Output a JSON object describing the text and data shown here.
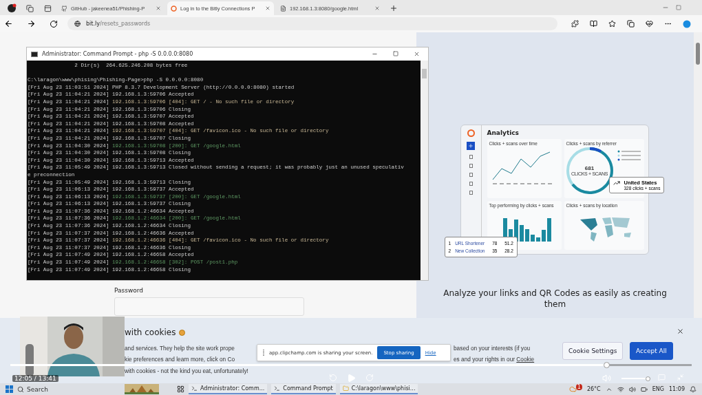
{
  "browser": {
    "tabs": [
      {
        "label": "GitHub - jakeenea51/Phishing-P",
        "kind": "github",
        "selected": false
      },
      {
        "label": "Log in to the Bitly Connections P",
        "kind": "bitly",
        "selected": true
      },
      {
        "label": "192.168.1.3:8080/google.html",
        "kind": "page",
        "selected": false
      }
    ],
    "address": {
      "host": "bit.ly",
      "path": "/resets_passwords"
    }
  },
  "cmd": {
    "title": "Administrator: Command Prompt - php  -S 0.0.0.0:8080",
    "lines": [
      {
        "text": "               2 Dir(s)  264.625.246.208 bytes free",
        "kind": "plain"
      },
      {
        "kind": "blank"
      },
      {
        "text": "C:\\laragon\\www\\phising\\Phishing-Page>php -S 0.0.0.0:8080",
        "kind": "plain"
      },
      {
        "stamp": "[Fri Aug 23 11:03:51 2024]",
        "text": "PHP 8.3.7 Development Server (http://0.0.0.0:8080) started",
        "kind": "plain"
      },
      {
        "stamp": "[Fri Aug 23 11:04:21 2024]",
        "text": "192.168.1.3:59706 Accepted",
        "kind": "plain"
      },
      {
        "stamp": "[Fri Aug 23 11:04:21 2024]",
        "text": "192.168.1.3:59706 [404]: GET / - No such file or directory",
        "kind": "warn"
      },
      {
        "stamp": "[Fri Aug 23 11:04:21 2024]",
        "text": "192.168.1.3:59706 Closing",
        "kind": "plain"
      },
      {
        "stamp": "[Fri Aug 23 11:04:21 2024]",
        "text": "192.168.1.3:59707 Accepted",
        "kind": "plain"
      },
      {
        "stamp": "[Fri Aug 23 11:04:21 2024]",
        "text": "192.168.1.3:59708 Accepted",
        "kind": "plain"
      },
      {
        "stamp": "[Fri Aug 23 11:04:21 2024]",
        "text": "192.168.1.3:59707 [404]: GET /favicon.ico - No such file or directory",
        "kind": "warn"
      },
      {
        "stamp": "[Fri Aug 23 11:04:21 2024]",
        "text": "192.168.1.3:59707 Closing",
        "kind": "plain"
      },
      {
        "stamp": "[Fri Aug 23 11:04:30 2024]",
        "text": "192.168.1.3:59708 [200]: GET /google.html",
        "kind": "ok"
      },
      {
        "stamp": "[Fri Aug 23 11:04:30 2024]",
        "text": "192.168.1.3:59708 Closing",
        "kind": "plain"
      },
      {
        "stamp": "[Fri Aug 23 11:04:30 2024]",
        "text": "192.168.1.3:59713 Accepted",
        "kind": "plain"
      },
      {
        "stamp": "[Fri Aug 23 11:05:49 2024]",
        "text": "192.168.1.3:59713 Closed without sending a request; it was probably just an unused speculativ",
        "kind": "plain"
      },
      {
        "text": "e preconnection",
        "kind": "plain"
      },
      {
        "stamp": "[Fri Aug 23 11:05:49 2024]",
        "text": "192.168.1.3:59713 Closing",
        "kind": "plain"
      },
      {
        "stamp": "[Fri Aug 23 11:06:13 2024]",
        "text": "192.168.1.3:59737 Accepted",
        "kind": "plain"
      },
      {
        "stamp": "[Fri Aug 23 11:06:13 2024]",
        "text": "192.168.1.3:59737 [200]: GET /google.html",
        "kind": "ok"
      },
      {
        "stamp": "[Fri Aug 23 11:06:13 2024]",
        "text": "192.168.1.3:59737 Closing",
        "kind": "plain"
      },
      {
        "stamp": "[Fri Aug 23 11:07:36 2024]",
        "text": "192.168.1.2:46634 Accepted",
        "kind": "plain"
      },
      {
        "stamp": "[Fri Aug 23 11:07:36 2024]",
        "text": "192.168.1.2:46634 [200]: GET /google.html",
        "kind": "ok"
      },
      {
        "stamp": "[Fri Aug 23 11:07:36 2024]",
        "text": "192.168.1.2:46634 Closing",
        "kind": "plain"
      },
      {
        "stamp": "[Fri Aug 23 11:07:37 2024]",
        "text": "192.168.1.2:46636 Accepted",
        "kind": "plain"
      },
      {
        "stamp": "[Fri Aug 23 11:07:37 2024]",
        "text": "192.168.1.2:46636 [404]: GET /favicon.ico - No such file or directory",
        "kind": "warn"
      },
      {
        "stamp": "[Fri Aug 23 11:07:37 2024]",
        "text": "192.168.1.2:46636 Closing",
        "kind": "plain"
      },
      {
        "stamp": "[Fri Aug 23 11:07:49 2024]",
        "text": "192.168.1.2:46658 Accepted",
        "kind": "plain"
      },
      {
        "stamp": "[Fri Aug 23 11:07:49 2024]",
        "text": "192.168.1.2:46658 [302]: POST /post1.php",
        "kind": "ok"
      },
      {
        "stamp": "[Fri Aug 23 11:07:49 2024]",
        "text": "192.168.1.2:46658 Closing",
        "kind": "plain"
      }
    ]
  },
  "login": {
    "password_label": "Password"
  },
  "promo": {
    "title": "Analytics",
    "panels": [
      "Clicks + scans over time",
      "Clicks + scans by referrer",
      "Top performing by clicks + scans",
      "Clicks + scans by location"
    ],
    "donut_value": "681",
    "donut_label": "CLICKS + SCANS",
    "location": {
      "country": "United States",
      "reading": "328 clicks + scans"
    },
    "top_rows": [
      {
        "rank": "1",
        "name": "URL Shortener",
        "clicks": "78",
        "share": "51.2"
      },
      {
        "rank": "2",
        "name": "New Collection",
        "clicks": "35",
        "share": "28.2"
      }
    ],
    "caption": "Analyze your links and QR Codes as easily as creating them"
  },
  "cookie": {
    "title": "with cookies",
    "left_lines": [
      "and services. They help the site work prope",
      "kie preferences and learn more, click on Co",
      "with cookies - not the kind you eat, unfortunately!"
    ],
    "right_lines": [
      "based on your interests (if you",
      "es and your rights in our"
    ],
    "link": "Cookie",
    "buttons": [
      {
        "label": "Cookie Settings",
        "kind": "secondary"
      },
      {
        "label": "Accept All",
        "kind": "primary"
      }
    ]
  },
  "sharing": {
    "message": "app.clipchamp.com is sharing your screen.",
    "stop": "Stop sharing",
    "hide": "Hide"
  },
  "player": {
    "time": "12:05 / 13:41",
    "level": 0.875,
    "volume": {
      "level": 0.9
    }
  },
  "taskbar": {
    "search": "Search",
    "apps": [
      {
        "label": "Administrator: Comm...",
        "kind": "cmd"
      },
      {
        "label": "Command Prompt",
        "kind": "cmd"
      },
      {
        "label": "C:\\laragon\\www\\phisi...",
        "kind": "folder"
      }
    ],
    "badge": "1",
    "weather": "26°C",
    "lang": "ENG",
    "clock": "11:09"
  }
}
